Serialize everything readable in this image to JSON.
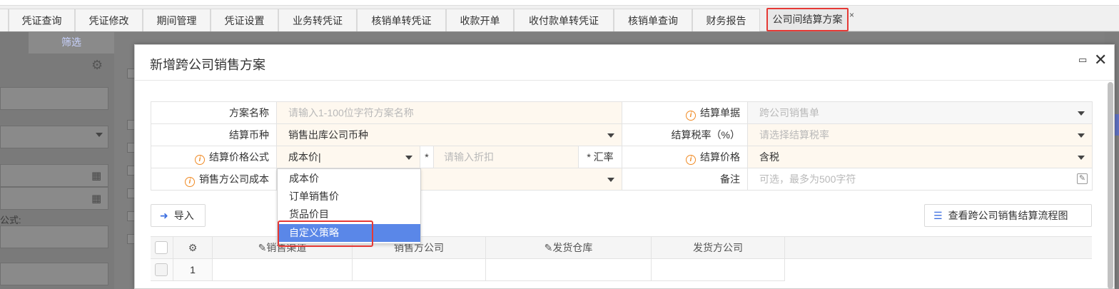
{
  "tabs": [
    {
      "label": "凭证查询"
    },
    {
      "label": "凭证修改"
    },
    {
      "label": "期间管理"
    },
    {
      "label": "凭证设置"
    },
    {
      "label": "业务转凭证"
    },
    {
      "label": "核销单转凭证"
    },
    {
      "label": "收款开单"
    },
    {
      "label": "收付款单转凭证"
    },
    {
      "label": "核销单查询"
    },
    {
      "label": "财务报告"
    },
    {
      "label": "公司间结算方案",
      "active": true
    }
  ],
  "tab_close": "×",
  "background": {
    "filter_label": "筛选",
    "formula_label": "公式:"
  },
  "modal": {
    "title": "新增跨公司销售方案",
    "maximize_icon": "maximize-icon",
    "close_icon": "close-icon",
    "close_glyph": "✕",
    "maximize_glyph": "▭"
  },
  "form": {
    "scheme_name_label": "方案名称",
    "scheme_name_placeholder": "请输入1-100位字符方案名称",
    "settle_doc_label": "结算单据",
    "settle_doc_value": "跨公司销售单",
    "currency_label": "结算币种",
    "currency_value": "销售出库公司币种",
    "tax_rate_label": "结算税率（%）",
    "tax_rate_placeholder": "请选择结算税率",
    "price_formula_label": "结算价格公式",
    "price_formula_value": "成本价",
    "star1": "*",
    "discount_placeholder": "请输入折扣",
    "star2": "*",
    "exchange_label": "汇率",
    "settle_price_label": "结算价格",
    "settle_price_value": "含税",
    "seller_cost_label": "销售方公司成本",
    "remark_label": "备注",
    "remark_placeholder": "可选，最多为500字符"
  },
  "dropdown": {
    "options": [
      "成本价",
      "订单销售价",
      "货品价目",
      "自定义策略"
    ],
    "selected_index": 3
  },
  "buttons": {
    "import_label": "导入",
    "flow_label": "查看跨公司销售结算流程图"
  },
  "table": {
    "headers": [
      "销售渠道",
      "销售方公司",
      "发货仓库",
      "发货方公司"
    ],
    "row_numbers": [
      "1"
    ]
  },
  "colors": {
    "accent": "#5a87e8",
    "highlight": "#e53935",
    "info": "#f08a24"
  }
}
